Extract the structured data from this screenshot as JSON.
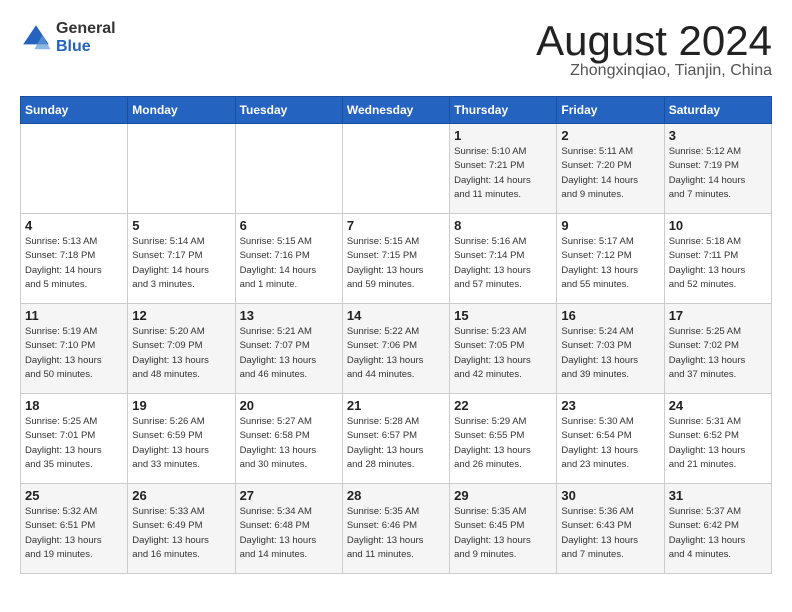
{
  "logo": {
    "general": "General",
    "blue": "Blue"
  },
  "title": {
    "month_year": "August 2024",
    "location": "Zhongxinqiao, Tianjin, China"
  },
  "days_of_week": [
    "Sunday",
    "Monday",
    "Tuesday",
    "Wednesday",
    "Thursday",
    "Friday",
    "Saturday"
  ],
  "weeks": [
    [
      {
        "day": "",
        "info": ""
      },
      {
        "day": "",
        "info": ""
      },
      {
        "day": "",
        "info": ""
      },
      {
        "day": "",
        "info": ""
      },
      {
        "day": "1",
        "info": "Sunrise: 5:10 AM\nSunset: 7:21 PM\nDaylight: 14 hours\nand 11 minutes."
      },
      {
        "day": "2",
        "info": "Sunrise: 5:11 AM\nSunset: 7:20 PM\nDaylight: 14 hours\nand 9 minutes."
      },
      {
        "day": "3",
        "info": "Sunrise: 5:12 AM\nSunset: 7:19 PM\nDaylight: 14 hours\nand 7 minutes."
      }
    ],
    [
      {
        "day": "4",
        "info": "Sunrise: 5:13 AM\nSunset: 7:18 PM\nDaylight: 14 hours\nand 5 minutes."
      },
      {
        "day": "5",
        "info": "Sunrise: 5:14 AM\nSunset: 7:17 PM\nDaylight: 14 hours\nand 3 minutes."
      },
      {
        "day": "6",
        "info": "Sunrise: 5:15 AM\nSunset: 7:16 PM\nDaylight: 14 hours\nand 1 minute."
      },
      {
        "day": "7",
        "info": "Sunrise: 5:15 AM\nSunset: 7:15 PM\nDaylight: 13 hours\nand 59 minutes."
      },
      {
        "day": "8",
        "info": "Sunrise: 5:16 AM\nSunset: 7:14 PM\nDaylight: 13 hours\nand 57 minutes."
      },
      {
        "day": "9",
        "info": "Sunrise: 5:17 AM\nSunset: 7:12 PM\nDaylight: 13 hours\nand 55 minutes."
      },
      {
        "day": "10",
        "info": "Sunrise: 5:18 AM\nSunset: 7:11 PM\nDaylight: 13 hours\nand 52 minutes."
      }
    ],
    [
      {
        "day": "11",
        "info": "Sunrise: 5:19 AM\nSunset: 7:10 PM\nDaylight: 13 hours\nand 50 minutes."
      },
      {
        "day": "12",
        "info": "Sunrise: 5:20 AM\nSunset: 7:09 PM\nDaylight: 13 hours\nand 48 minutes."
      },
      {
        "day": "13",
        "info": "Sunrise: 5:21 AM\nSunset: 7:07 PM\nDaylight: 13 hours\nand 46 minutes."
      },
      {
        "day": "14",
        "info": "Sunrise: 5:22 AM\nSunset: 7:06 PM\nDaylight: 13 hours\nand 44 minutes."
      },
      {
        "day": "15",
        "info": "Sunrise: 5:23 AM\nSunset: 7:05 PM\nDaylight: 13 hours\nand 42 minutes."
      },
      {
        "day": "16",
        "info": "Sunrise: 5:24 AM\nSunset: 7:03 PM\nDaylight: 13 hours\nand 39 minutes."
      },
      {
        "day": "17",
        "info": "Sunrise: 5:25 AM\nSunset: 7:02 PM\nDaylight: 13 hours\nand 37 minutes."
      }
    ],
    [
      {
        "day": "18",
        "info": "Sunrise: 5:25 AM\nSunset: 7:01 PM\nDaylight: 13 hours\nand 35 minutes."
      },
      {
        "day": "19",
        "info": "Sunrise: 5:26 AM\nSunset: 6:59 PM\nDaylight: 13 hours\nand 33 minutes."
      },
      {
        "day": "20",
        "info": "Sunrise: 5:27 AM\nSunset: 6:58 PM\nDaylight: 13 hours\nand 30 minutes."
      },
      {
        "day": "21",
        "info": "Sunrise: 5:28 AM\nSunset: 6:57 PM\nDaylight: 13 hours\nand 28 minutes."
      },
      {
        "day": "22",
        "info": "Sunrise: 5:29 AM\nSunset: 6:55 PM\nDaylight: 13 hours\nand 26 minutes."
      },
      {
        "day": "23",
        "info": "Sunrise: 5:30 AM\nSunset: 6:54 PM\nDaylight: 13 hours\nand 23 minutes."
      },
      {
        "day": "24",
        "info": "Sunrise: 5:31 AM\nSunset: 6:52 PM\nDaylight: 13 hours\nand 21 minutes."
      }
    ],
    [
      {
        "day": "25",
        "info": "Sunrise: 5:32 AM\nSunset: 6:51 PM\nDaylight: 13 hours\nand 19 minutes."
      },
      {
        "day": "26",
        "info": "Sunrise: 5:33 AM\nSunset: 6:49 PM\nDaylight: 13 hours\nand 16 minutes."
      },
      {
        "day": "27",
        "info": "Sunrise: 5:34 AM\nSunset: 6:48 PM\nDaylight: 13 hours\nand 14 minutes."
      },
      {
        "day": "28",
        "info": "Sunrise: 5:35 AM\nSunset: 6:46 PM\nDaylight: 13 hours\nand 11 minutes."
      },
      {
        "day": "29",
        "info": "Sunrise: 5:35 AM\nSunset: 6:45 PM\nDaylight: 13 hours\nand 9 minutes."
      },
      {
        "day": "30",
        "info": "Sunrise: 5:36 AM\nSunset: 6:43 PM\nDaylight: 13 hours\nand 7 minutes."
      },
      {
        "day": "31",
        "info": "Sunrise: 5:37 AM\nSunset: 6:42 PM\nDaylight: 13 hours\nand 4 minutes."
      }
    ]
  ]
}
